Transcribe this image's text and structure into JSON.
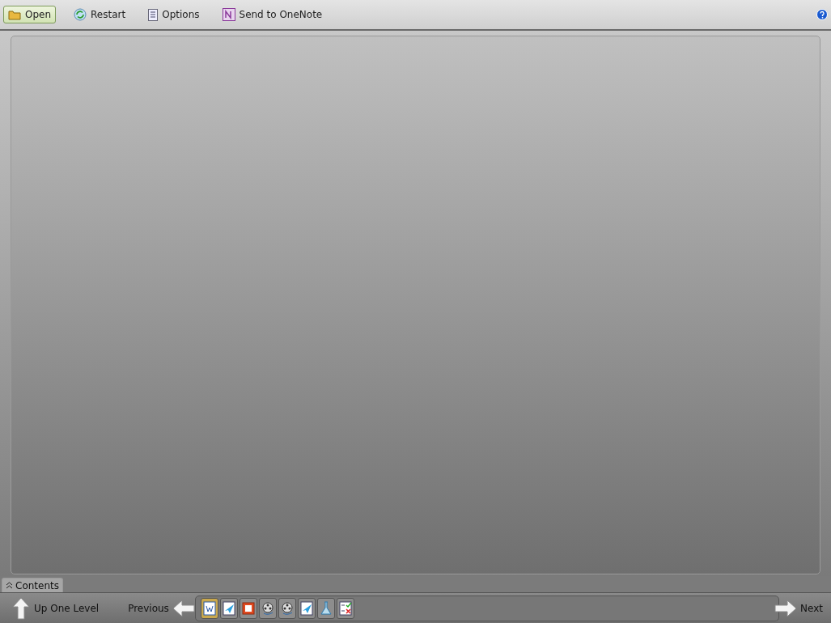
{
  "toolbar": {
    "buttons": [
      {
        "kind": "open",
        "label": "Open",
        "selected": true
      },
      {
        "kind": "restart",
        "label": "Restart",
        "selected": false
      },
      {
        "kind": "options",
        "label": "Options",
        "selected": false
      },
      {
        "kind": "onenote",
        "label": "Send to OneNote",
        "selected": false
      }
    ]
  },
  "contents_tab": {
    "label": "Contents",
    "expanded": false
  },
  "navigation": {
    "up": "Up One Level",
    "previous": "Previous",
    "next": "Next",
    "thumbnails": [
      {
        "kind": "document",
        "selected": true
      },
      {
        "kind": "send",
        "selected": false
      },
      {
        "kind": "presentation",
        "selected": false
      },
      {
        "kind": "video",
        "selected": false
      },
      {
        "kind": "video",
        "selected": false
      },
      {
        "kind": "send",
        "selected": false
      },
      {
        "kind": "flask",
        "selected": false
      },
      {
        "kind": "checklist",
        "selected": false
      }
    ]
  }
}
